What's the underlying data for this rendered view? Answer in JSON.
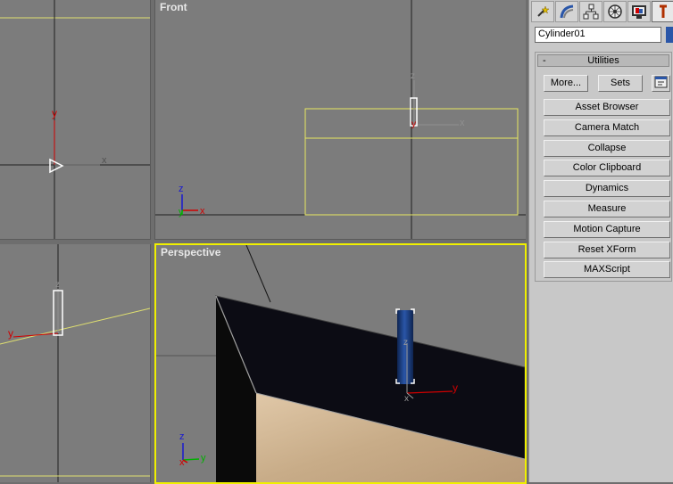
{
  "viewports": {
    "top": {
      "label": ""
    },
    "front": {
      "label": "Front"
    },
    "left": {
      "label": ""
    },
    "perspective": {
      "label": "Perspective"
    }
  },
  "axis_labels": {
    "x": "x",
    "y": "y",
    "z": "z"
  },
  "command_panel": {
    "tabs": [
      {
        "icon": "create-icon"
      },
      {
        "icon": "modify-icon"
      },
      {
        "icon": "hierarchy-icon"
      },
      {
        "icon": "motion-icon"
      },
      {
        "icon": "display-icon"
      },
      {
        "icon": "utilities-icon",
        "active": true
      }
    ],
    "object_name": "Cylinder01",
    "object_color": "#2a56a8",
    "utilities": {
      "collapse_symbol": "-",
      "title": "Utilities",
      "more_label": "More...",
      "sets_label": "Sets",
      "buttons": [
        "Asset Browser",
        "Camera Match",
        "Collapse",
        "Color Clipboard",
        "Dynamics",
        "Measure",
        "Motion Capture",
        "Reset XForm",
        "MAXScript"
      ]
    }
  },
  "colors": {
    "viewport_bg": "#7c7c7c",
    "active_border": "#f0f000",
    "selection": "#ffff66",
    "cylinder": "#1a3a78"
  }
}
